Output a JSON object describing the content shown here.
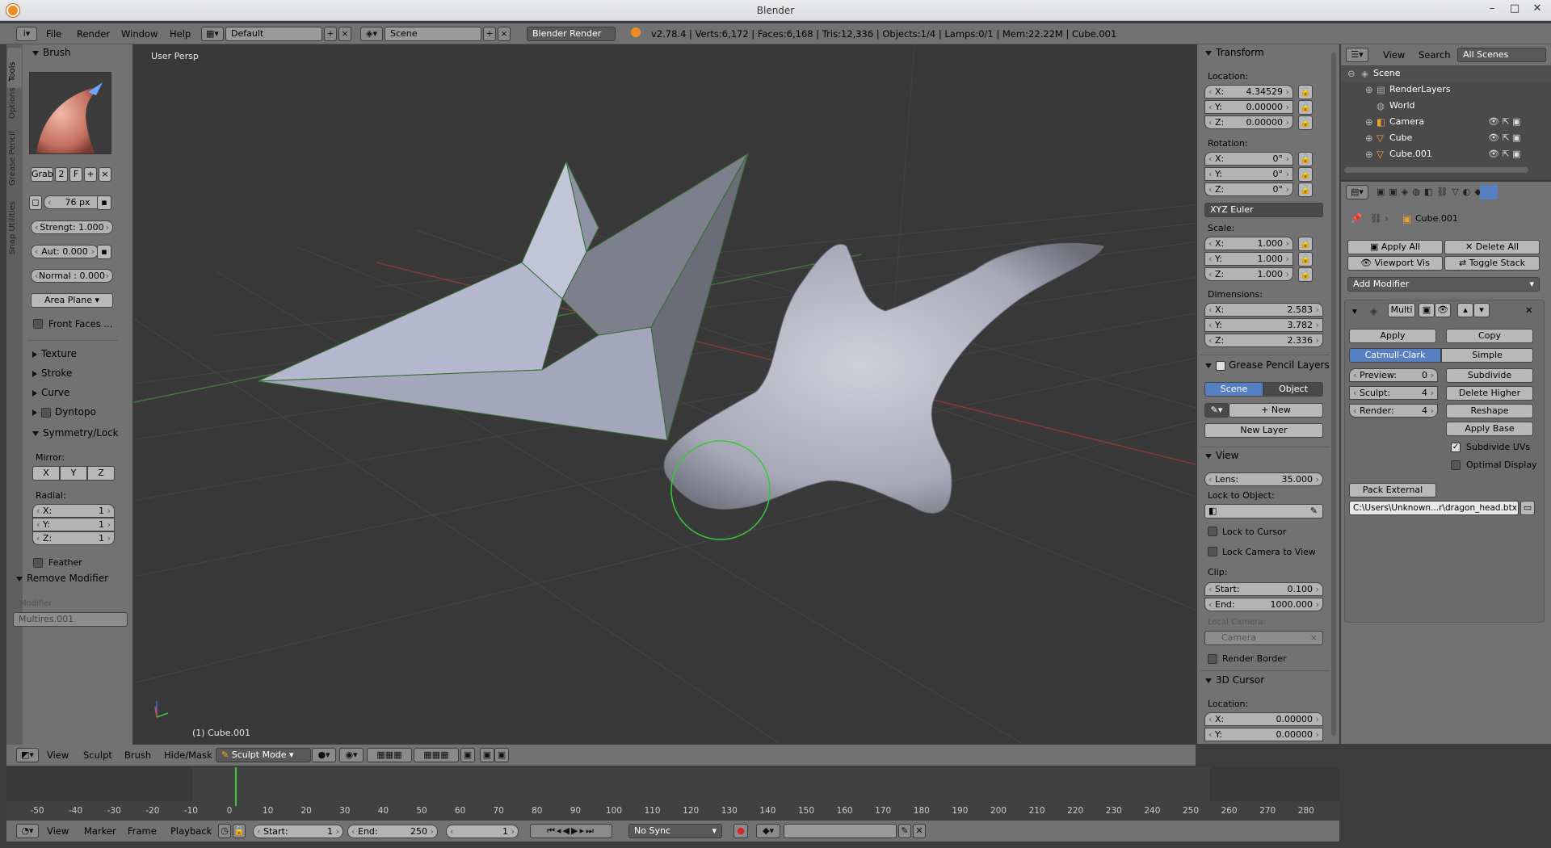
{
  "window": {
    "title": "Blender"
  },
  "infobar": {
    "menus": [
      "File",
      "Render",
      "Window",
      "Help"
    ],
    "layout": "Default",
    "scene": "Scene",
    "engine": "Blender Render",
    "stats": "v2.78.4 | Verts:6,172 | Faces:6,168 | Tris:12,336 | Objects:1/4 | Lamps:0/1 | Mem:22.22M | Cube.001"
  },
  "toolshelf": {
    "tabs": [
      "Tools",
      "Options",
      "Grease Pencil",
      "Snap Utilities"
    ],
    "brush_header": "Brush",
    "brush_name": "Grab",
    "brush_users": "2",
    "brush_fake": "F",
    "radius": "76 px",
    "strength": "Strengt:  1.000",
    "autosmooth": "Aut:  0.000",
    "normal": "Normal : 0.000",
    "area": "Area Plane",
    "front_faces": "Front Faces ...",
    "sections": [
      "Texture",
      "Stroke",
      "Curve",
      "Dyntopo"
    ],
    "symmetry_header": "Symmetry/Lock",
    "mirror_label": "Mirror:",
    "mirror": [
      "X",
      "Y",
      "Z"
    ],
    "radial_label": "Radial:",
    "radial": [
      {
        "k": "X:",
        "v": "1"
      },
      {
        "k": "Y:",
        "v": "1"
      },
      {
        "k": "Z:",
        "v": "1"
      }
    ],
    "feather": "Feather",
    "remove_modifier": "Remove Modifier",
    "modifier_label": "Modifier",
    "modifier_value": "Multires.001"
  },
  "viewport": {
    "label": "User Persp",
    "object": "(1) Cube.001",
    "colors": {
      "bg": "#393939",
      "grid": "#4a4a4a",
      "mesh": "#a6a8c2",
      "sculpt": "#b4b4c4",
      "brush": "#39c839"
    }
  },
  "viewheader": {
    "menus": [
      "View",
      "Sculpt",
      "Brush",
      "Hide/Mask"
    ],
    "mode": "Sculpt Mode"
  },
  "properties_n": {
    "transform": "Transform",
    "location_label": "Location:",
    "location": [
      {
        "k": "X:",
        "v": "4.34529"
      },
      {
        "k": "Y:",
        "v": "0.00000"
      },
      {
        "k": "Z:",
        "v": "0.00000"
      }
    ],
    "rotation_label": "Rotation:",
    "rotation": [
      {
        "k": "X:",
        "v": "0°"
      },
      {
        "k": "Y:",
        "v": "0°"
      },
      {
        "k": "Z:",
        "v": "0°"
      }
    ],
    "rotation_mode": "XYZ Euler",
    "scale_label": "Scale:",
    "scale": [
      {
        "k": "X:",
        "v": "1.000"
      },
      {
        "k": "Y:",
        "v": "1.000"
      },
      {
        "k": "Z:",
        "v": "1.000"
      }
    ],
    "dimensions_label": "Dimensions:",
    "dimensions": [
      {
        "k": "X:",
        "v": "2.583"
      },
      {
        "k": "Y:",
        "v": "3.782"
      },
      {
        "k": "Z:",
        "v": "2.336"
      }
    ],
    "gp_layers": "Grease Pencil Layers",
    "gp_scene": "Scene",
    "gp_object": "Object",
    "gp_new": "New",
    "gp_new_layer": "New Layer",
    "view": "View",
    "lens": {
      "k": "Lens:",
      "v": "35.000"
    },
    "lock_to_object": "Lock to Object:",
    "lock_to_cursor": "Lock to Cursor",
    "lock_camera": "Lock Camera to View",
    "clip_label": "Clip:",
    "clip_start": {
      "k": "Start:",
      "v": "0.100"
    },
    "clip_end": {
      "k": "End:",
      "v": "1000.000"
    },
    "local_camera_label": "Local Camera:",
    "local_camera": "Camera",
    "render_border": "Render Border",
    "cursor": "3D Cursor",
    "cursor_location_label": "Location:",
    "cursor_location": [
      {
        "k": "X:",
        "v": "0.00000"
      },
      {
        "k": "Y:",
        "v": "0.00000"
      }
    ]
  },
  "outliner": {
    "menus": [
      "View",
      "Search"
    ],
    "filter": "All Scenes",
    "items": [
      "Scene",
      "RenderLayers",
      "World",
      "Camera",
      "Cube",
      "Cube.001"
    ]
  },
  "props_editor": {
    "breadcrumb": "Cube.001",
    "apply_all": "Apply All",
    "delete_all": "Delete All",
    "viewport_vis": "Viewport Vis",
    "toggle_stack": "Toggle Stack",
    "add_modifier": "Add Modifier",
    "modifier_name": "Multi",
    "apply": "Apply",
    "copy": "Copy",
    "catmull": "Catmull-Clark",
    "simple": "Simple",
    "preview": {
      "k": "Preview:",
      "v": "0"
    },
    "sculpt": {
      "k": "Sculpt:",
      "v": "4"
    },
    "render": {
      "k": "Render:",
      "v": "4"
    },
    "subdivide": "Subdivide",
    "delete_higher": "Delete Higher",
    "reshape": "Reshape",
    "apply_base": "Apply Base",
    "subdivide_uvs": "Subdivide UVs",
    "optimal_display": "Optimal Display",
    "pack_external": "Pack External",
    "path": "C:\\Users\\Unknown...r\\dragon_head.btx"
  },
  "timeline": {
    "ticks": [
      "-50",
      "-40",
      "-30",
      "-20",
      "-10",
      "0",
      "10",
      "20",
      "30",
      "40",
      "50",
      "60",
      "70",
      "80",
      "90",
      "100",
      "110",
      "120",
      "130",
      "140",
      "150",
      "160",
      "170",
      "180",
      "190",
      "200",
      "210",
      "220",
      "230",
      "240",
      "250",
      "260",
      "270",
      "280"
    ],
    "menus": [
      "View",
      "Marker",
      "Frame",
      "Playback"
    ],
    "start": {
      "k": "Start:",
      "v": "1"
    },
    "end": {
      "k": "End:",
      "v": "250"
    },
    "current": "1",
    "sync": "No Sync"
  }
}
